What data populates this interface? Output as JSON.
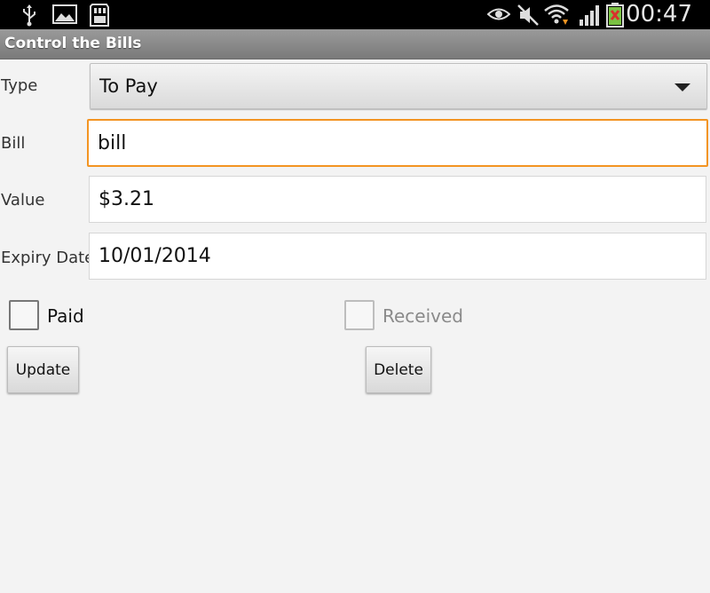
{
  "status_bar": {
    "time": "00:47",
    "icons": [
      "usb-icon",
      "image-icon",
      "sd-card-icon",
      "eye-icon",
      "mute-icon",
      "wifi-icon",
      "signal-icon",
      "battery-icon"
    ]
  },
  "app": {
    "title": "Control the Bills"
  },
  "form": {
    "type_label": "Type",
    "type_value": "To Pay",
    "bill_label": "Bill",
    "bill_value": "bill",
    "value_label": "Value",
    "value_value": "$3.21",
    "expiry_label": "Expiry Date",
    "expiry_value": "10/01/2014",
    "paid_label": "Paid",
    "received_label": "Received",
    "update_label": "Update",
    "delete_label": "Delete"
  },
  "colors": {
    "focus_accent": "#f39422",
    "title_bar": "#8a8a8a"
  }
}
